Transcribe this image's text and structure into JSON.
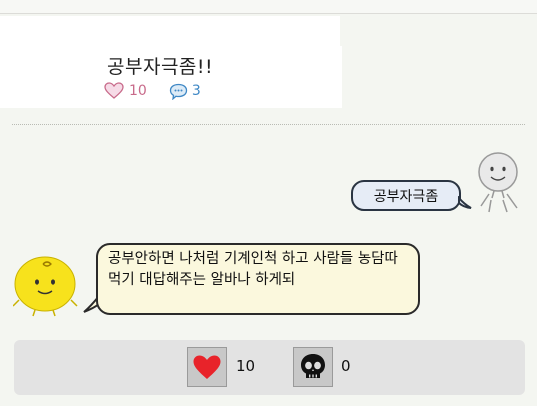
{
  "post": {
    "title": "공부자극좀!!",
    "likes": "10",
    "comments": "3"
  },
  "chat": {
    "user_message": "공부자극좀",
    "bot_reply": "공부안하면 나처럼 기계인척 하고 사람들 농담따먹기 대답해주는 알바나 하게되"
  },
  "reactions": {
    "like_count": "10",
    "dislike_count": "0"
  },
  "colors": {
    "like_heart": "#e8232a",
    "bubble_user": "#e6ecf6",
    "bubble_bot": "#fbf8dd",
    "bot_avatar": "#f7e21c"
  }
}
